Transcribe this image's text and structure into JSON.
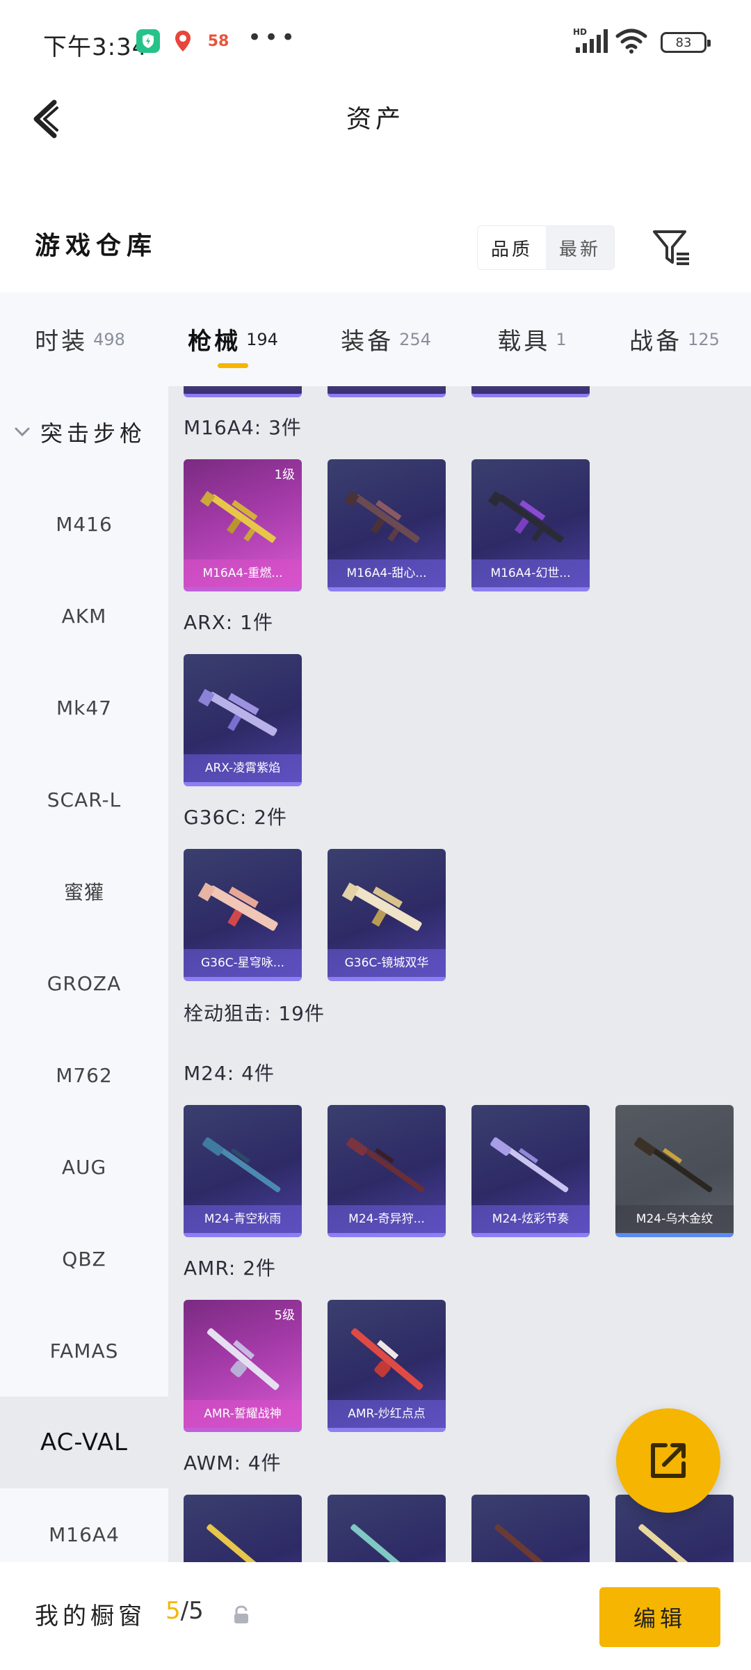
{
  "status_bar": {
    "time": "下午3:34",
    "battery": "83",
    "network": "HD"
  },
  "title_bar": {
    "title": "资产"
  },
  "header": {
    "title": "游戏仓库",
    "sort_options": [
      "品质",
      "最新"
    ],
    "active_sort": "品质"
  },
  "category_tabs": [
    {
      "label": "时装",
      "count": "498"
    },
    {
      "label": "枪械",
      "count": "194",
      "active": true
    },
    {
      "label": "装备",
      "count": "254"
    },
    {
      "label": "载具",
      "count": "1"
    },
    {
      "label": "战备",
      "count": "125"
    }
  ],
  "sidebar": {
    "group": "突击步枪",
    "items": [
      "M416",
      "AKM",
      "Mk47",
      "SCAR-L",
      "蜜獾",
      "GROZA",
      "M762",
      "AUG",
      "QBZ",
      "FAMAS",
      "AC-VAL",
      "M16A4"
    ],
    "active": "AC-VAL"
  },
  "content": {
    "sections": [
      {
        "label": "M16A4: 3件"
      },
      {
        "label": "ARX: 1件"
      },
      {
        "label": "G36C: 2件"
      },
      {
        "label": "栓动狙击: 19件"
      },
      {
        "label": "M24: 4件"
      },
      {
        "label": "AMR: 2件"
      },
      {
        "label": "AWM: 4件"
      }
    ],
    "cards": {
      "m16a4": [
        {
          "name": "M16A4-重燃...",
          "level": "1级"
        },
        {
          "name": "M16A4-甜心..."
        },
        {
          "name": "M16A4-幻世..."
        }
      ],
      "arx": [
        {
          "name": "ARX-凌霄紫焰"
        }
      ],
      "g36c": [
        {
          "name": "G36C-星穹咏..."
        },
        {
          "name": "G36C-镜城双华"
        }
      ],
      "m24": [
        {
          "name": "M24-青空秋雨"
        },
        {
          "name": "M24-奇异狩..."
        },
        {
          "name": "M24-炫彩节奏"
        },
        {
          "name": "M24-乌木金纹"
        }
      ],
      "amr": [
        {
          "name": "AMR-誓耀战神",
          "level": "5级"
        },
        {
          "name": "AMR-炒红点点"
        }
      ]
    }
  },
  "bottom_bar": {
    "label": "我的橱窗",
    "current": "5",
    "total": "/5",
    "edit_label": "编辑"
  },
  "colors": {
    "accent": "#f5b500",
    "card_purple": "#2e2a66",
    "card_pink": "#a43aa8",
    "card_grey": "#4a4e57"
  }
}
